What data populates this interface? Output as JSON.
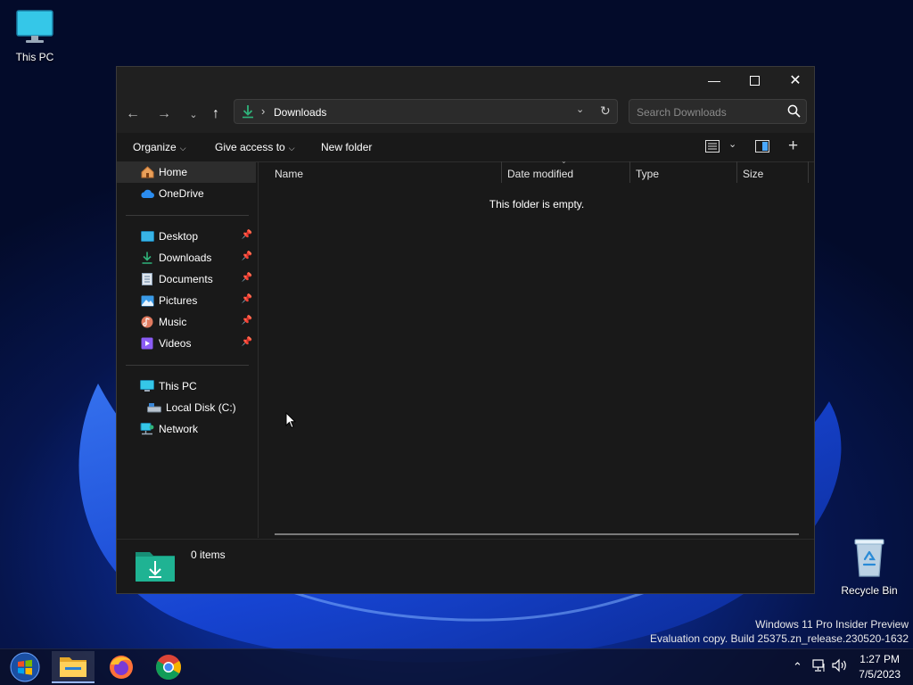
{
  "desktop": {
    "this_pc_label": "This PC",
    "recycle_bin_label": "Recycle Bin"
  },
  "watermark": {
    "line1": "Windows 11 Pro Insider Preview",
    "line2": "Evaluation copy. Build 25375.zn_release.230520-1632"
  },
  "window": {
    "address": {
      "crumb": "Downloads",
      "separator": "›"
    },
    "search": {
      "placeholder": "Search Downloads"
    },
    "toolbar": {
      "organize": "Organize",
      "give_access": "Give access to",
      "new_folder": "New folder"
    },
    "sidebar": {
      "home": "Home",
      "onedrive": "OneDrive",
      "quick_access": [
        "Desktop",
        "Downloads",
        "Documents",
        "Pictures",
        "Music",
        "Videos"
      ],
      "this_pc": "This PC",
      "local_disk": "Local Disk (C:)",
      "network": "Network"
    },
    "columns": [
      "Name",
      "Date modified",
      "Type",
      "Size"
    ],
    "empty_message": "This folder is empty.",
    "status": {
      "item_count": "0 items"
    }
  },
  "taskbar": {
    "apps": [
      "start-icon",
      "file-explorer-icon",
      "firefox-icon",
      "chrome-icon"
    ],
    "clock": {
      "time": "1:27 PM",
      "date": "7/5/2023"
    }
  },
  "colors": {
    "accent_green": "#2fb37a",
    "folder_teal": "#1fa58a",
    "window_bg": "#191919",
    "chrome_bg": "#202020"
  }
}
